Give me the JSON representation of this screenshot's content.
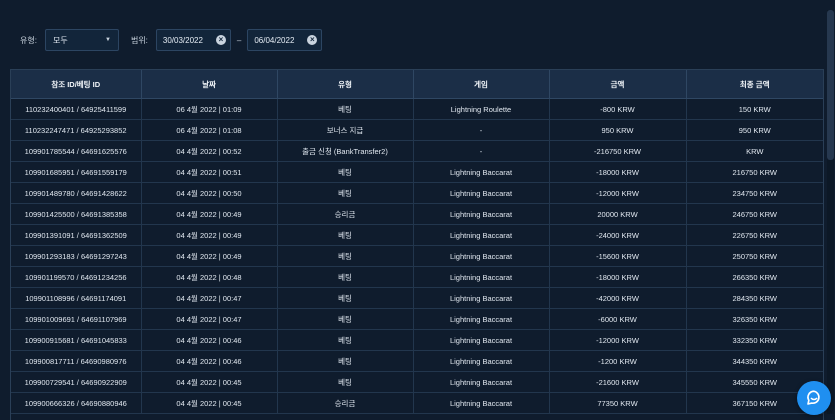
{
  "filters": {
    "type_label": "유형:",
    "type_value": "모두",
    "range_label": "범위:",
    "date_from": "30/03/2022",
    "date_to": "06/04/2022",
    "separator": "–"
  },
  "table": {
    "headers": [
      "참조 ID/베팅 ID",
      "날짜",
      "유형",
      "게임",
      "금액",
      "최종 금액"
    ],
    "rows": [
      [
        "110232400401 / 64925411599",
        "06 4월 2022 | 01:09",
        "베팅",
        "Lightning Roulette",
        "-800 KRW",
        "150 KRW"
      ],
      [
        "110232247471 / 64925293852",
        "06 4월 2022 | 01:08",
        "보너스 지급",
        "-",
        "950 KRW",
        "950 KRW"
      ],
      [
        "109901785544 / 64691625576",
        "04 4월 2022 | 00:52",
        "출금 신청 (BankTransfer2)",
        "-",
        "-216750 KRW",
        "KRW"
      ],
      [
        "109901685951 / 64691559179",
        "04 4월 2022 | 00:51",
        "베팅",
        "Lightning Baccarat",
        "-18000 KRW",
        "216750 KRW"
      ],
      [
        "109901489780 / 64691428622",
        "04 4월 2022 | 00:50",
        "베팅",
        "Lightning Baccarat",
        "-12000 KRW",
        "234750 KRW"
      ],
      [
        "109901425500 / 64691385358",
        "04 4월 2022 | 00:49",
        "승리금",
        "Lightning Baccarat",
        "20000 KRW",
        "246750 KRW"
      ],
      [
        "109901391091 / 64691362509",
        "04 4월 2022 | 00:49",
        "베팅",
        "Lightning Baccarat",
        "-24000 KRW",
        "226750 KRW"
      ],
      [
        "109901293183 / 64691297243",
        "04 4월 2022 | 00:49",
        "베팅",
        "Lightning Baccarat",
        "-15600 KRW",
        "250750 KRW"
      ],
      [
        "109901199570 / 64691234256",
        "04 4월 2022 | 00:48",
        "베팅",
        "Lightning Baccarat",
        "-18000 KRW",
        "266350 KRW"
      ],
      [
        "109901108996 / 64691174091",
        "04 4월 2022 | 00:47",
        "베팅",
        "Lightning Baccarat",
        "-42000 KRW",
        "284350 KRW"
      ],
      [
        "109901009691 / 64691107969",
        "04 4월 2022 | 00:47",
        "베팅",
        "Lightning Baccarat",
        "-6000 KRW",
        "326350 KRW"
      ],
      [
        "109900915681 / 64691045833",
        "04 4월 2022 | 00:46",
        "베팅",
        "Lightning Baccarat",
        "-12000 KRW",
        "332350 KRW"
      ],
      [
        "109900817711 / 64690980976",
        "04 4월 2022 | 00:46",
        "베팅",
        "Lightning Baccarat",
        "-1200 KRW",
        "344350 KRW"
      ],
      [
        "109900729541 / 64690922909",
        "04 4월 2022 | 00:45",
        "베팅",
        "Lightning Baccarat",
        "-21600 KRW",
        "345550 KRW"
      ],
      [
        "109900666326 / 64690880946",
        "04 4월 2022 | 00:45",
        "승리금",
        "Lightning Baccarat",
        "77350 KRW",
        "367150 KRW"
      ]
    ]
  },
  "icons": {
    "clear": "clear-icon",
    "caret": "chevron-down-icon",
    "chat": "chat-icon"
  },
  "colors": {
    "background": "#0f1c2d",
    "header": "#1b2e47",
    "chat_button": "#1f8ff0"
  }
}
